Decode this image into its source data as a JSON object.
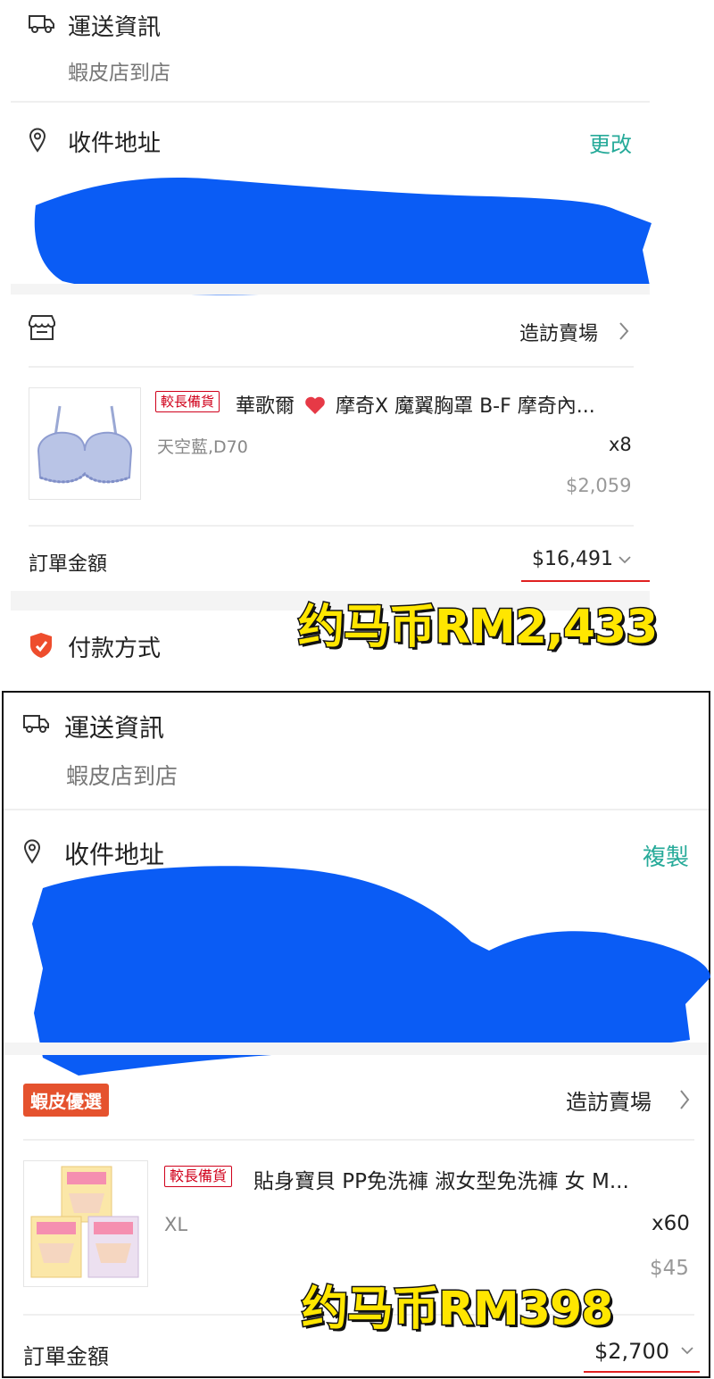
{
  "panel1": {
    "shipping": {
      "title": "運送資訊",
      "method": "蝦皮店到店"
    },
    "address": {
      "title": "收件地址",
      "action": "更改"
    },
    "shop": {
      "visit_label": "造訪賣場"
    },
    "product": {
      "tag": "較長備貨",
      "name_prefix": "華歌爾",
      "name_suffix": "摩奇X 魔翼胸罩 B-F 摩奇內...",
      "variant": "天空藍,D70",
      "qty": "x8",
      "price": "$2,059"
    },
    "order_total": {
      "label": "訂單金額",
      "value": "$16,491"
    },
    "annotation": "约马币RM2,433",
    "payment": {
      "title": "付款方式"
    }
  },
  "panel2": {
    "shipping": {
      "title": "運送資訊",
      "method": "蝦皮店到店"
    },
    "address": {
      "title": "收件地址",
      "action": "複製"
    },
    "shop": {
      "badge": "蝦皮優選",
      "visit_label": "造訪賣場"
    },
    "product": {
      "tag": "較長備貨",
      "name": "貼身寶貝 PP免洗褲 淑女型免洗褲 女 M...",
      "variant": "XL",
      "qty": "x60",
      "price": "$45"
    },
    "order_total": {
      "label": "訂單金額",
      "value": "$2,700"
    },
    "annotation": "约马币RM398"
  },
  "colors": {
    "accent_teal": "#26aa99",
    "shopee_orange": "#e5522e",
    "redact_blue": "#0a5cf5",
    "annotation_yellow": "#ffe600",
    "underline_red": "#e02020"
  },
  "icons": [
    "truck-icon",
    "location-pin-icon",
    "store-icon",
    "heart-icon",
    "shield-icon",
    "chevron-right-icon",
    "chevron-down-icon"
  ]
}
